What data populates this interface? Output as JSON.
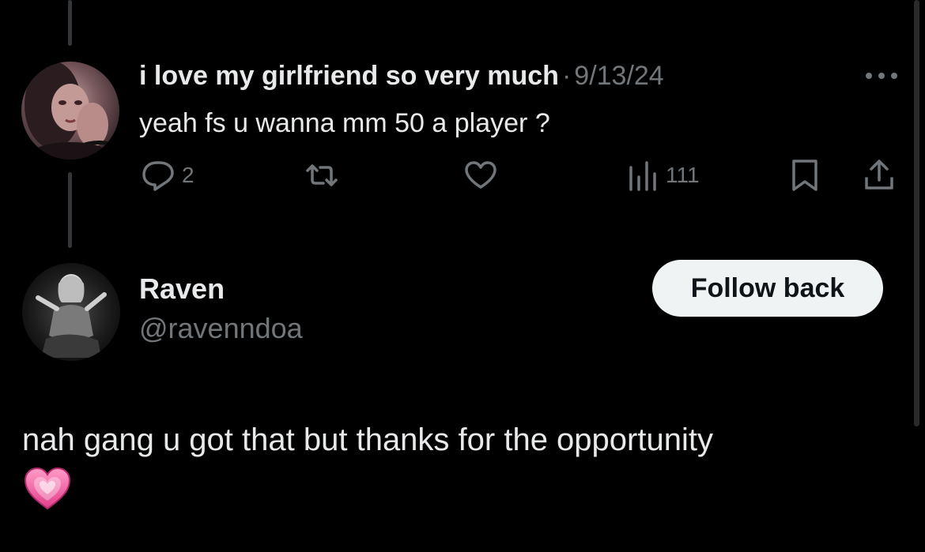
{
  "reply": {
    "display_name": "i love my girlfriend so very much",
    "separator": "·",
    "date": "9/13/24",
    "text": "yeah fs u wanna mm 50 a player ?",
    "actions": {
      "replies": "2",
      "views": "111"
    }
  },
  "profile": {
    "name": "Raven",
    "handle": "@ravenndoa",
    "follow_label": "Follow back"
  },
  "post": {
    "text": "nah gang u got that but thanks for the opportunity",
    "emoji_icon": "pink-heart-icon"
  },
  "colors": {
    "background": "#000000",
    "primary_text": "#e7e9ea",
    "secondary_text": "#71767b",
    "button_bg": "#eff3f4",
    "button_text": "#0f1419",
    "heart": "#f25b9a"
  }
}
